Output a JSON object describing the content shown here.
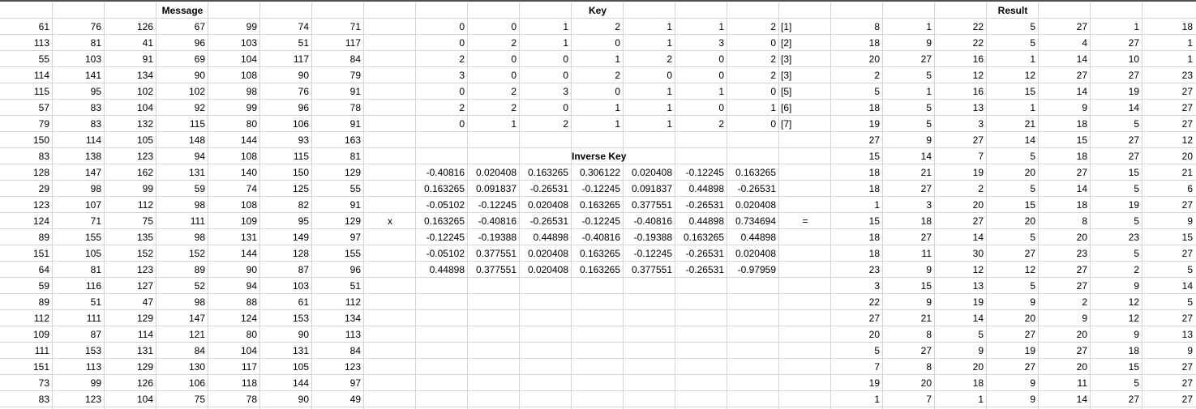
{
  "headers": {
    "message": "Message",
    "key": "Key",
    "inverse_key": "Inverse Key",
    "result": "Result"
  },
  "operators": {
    "multiply": "x",
    "equals": "="
  },
  "message": [
    [
      "61",
      "76",
      "126",
      "67",
      "99",
      "74",
      "71"
    ],
    [
      "113",
      "81",
      "41",
      "96",
      "103",
      "51",
      "117"
    ],
    [
      "55",
      "103",
      "91",
      "69",
      "104",
      "117",
      "84"
    ],
    [
      "114",
      "141",
      "134",
      "90",
      "108",
      "90",
      "79"
    ],
    [
      "115",
      "95",
      "102",
      "102",
      "98",
      "76",
      "91"
    ],
    [
      "57",
      "83",
      "104",
      "92",
      "99",
      "96",
      "78"
    ],
    [
      "79",
      "83",
      "132",
      "115",
      "80",
      "106",
      "91"
    ],
    [
      "150",
      "114",
      "105",
      "148",
      "144",
      "93",
      "163"
    ],
    [
      "83",
      "138",
      "123",
      "94",
      "108",
      "115",
      "81"
    ],
    [
      "128",
      "147",
      "162",
      "131",
      "140",
      "150",
      "129"
    ],
    [
      "29",
      "98",
      "99",
      "59",
      "74",
      "125",
      "55"
    ],
    [
      "123",
      "107",
      "112",
      "98",
      "108",
      "82",
      "91"
    ],
    [
      "124",
      "71",
      "75",
      "111",
      "109",
      "95",
      "129"
    ],
    [
      "89",
      "155",
      "135",
      "98",
      "131",
      "149",
      "97"
    ],
    [
      "151",
      "105",
      "152",
      "152",
      "144",
      "128",
      "155"
    ],
    [
      "64",
      "81",
      "123",
      "89",
      "90",
      "87",
      "96"
    ],
    [
      "59",
      "116",
      "127",
      "52",
      "94",
      "103",
      "51"
    ],
    [
      "89",
      "51",
      "47",
      "98",
      "88",
      "61",
      "112"
    ],
    [
      "112",
      "111",
      "129",
      "147",
      "124",
      "153",
      "134"
    ],
    [
      "109",
      "87",
      "114",
      "121",
      "80",
      "90",
      "113"
    ],
    [
      "111",
      "153",
      "131",
      "84",
      "104",
      "131",
      "84"
    ],
    [
      "151",
      "113",
      "129",
      "130",
      "117",
      "105",
      "123"
    ],
    [
      "73",
      "99",
      "126",
      "106",
      "118",
      "144",
      "97"
    ],
    [
      "83",
      "123",
      "104",
      "75",
      "78",
      "90",
      "49"
    ]
  ],
  "key": [
    [
      "0",
      "0",
      "1",
      "2",
      "1",
      "1",
      "2"
    ],
    [
      "0",
      "2",
      "1",
      "0",
      "1",
      "3",
      "0"
    ],
    [
      "2",
      "0",
      "0",
      "1",
      "2",
      "0",
      "2"
    ],
    [
      "3",
      "0",
      "0",
      "2",
      "0",
      "0",
      "2"
    ],
    [
      "0",
      "2",
      "3",
      "0",
      "1",
      "1",
      "0"
    ],
    [
      "2",
      "2",
      "0",
      "1",
      "1",
      "0",
      "1"
    ],
    [
      "0",
      "1",
      "2",
      "1",
      "1",
      "2",
      "0"
    ]
  ],
  "key_tags": [
    "[1]",
    "[2]",
    "[3]",
    "[3]",
    "[5]",
    "[6]",
    "[7]"
  ],
  "inverse_key": [
    [
      "-0.40816",
      "0.020408",
      "0.163265",
      "0.306122",
      "0.020408",
      "-0.12245",
      "0.163265"
    ],
    [
      "0.163265",
      "0.091837",
      "-0.26531",
      "-0.12245",
      "0.091837",
      "0.44898",
      "-0.26531"
    ],
    [
      "-0.05102",
      "-0.12245",
      "0.020408",
      "0.163265",
      "0.377551",
      "-0.26531",
      "0.020408"
    ],
    [
      "0.163265",
      "-0.40816",
      "-0.26531",
      "-0.12245",
      "-0.40816",
      "0.44898",
      "0.734694"
    ],
    [
      "-0.12245",
      "-0.19388",
      "0.44898",
      "-0.40816",
      "-0.19388",
      "0.163265",
      "0.44898"
    ],
    [
      "-0.05102",
      "0.377551",
      "0.020408",
      "0.163265",
      "-0.12245",
      "-0.26531",
      "0.020408"
    ],
    [
      "0.44898",
      "0.377551",
      "0.020408",
      "0.163265",
      "0.377551",
      "-0.26531",
      "-0.97959"
    ]
  ],
  "result": [
    [
      "8",
      "1",
      "22",
      "5",
      "27",
      "1",
      "18"
    ],
    [
      "18",
      "9",
      "22",
      "5",
      "4",
      "27",
      "1"
    ],
    [
      "20",
      "27",
      "16",
      "1",
      "14",
      "10",
      "1"
    ],
    [
      "2",
      "5",
      "12",
      "12",
      "27",
      "27",
      "23"
    ],
    [
      "5",
      "1",
      "16",
      "15",
      "14",
      "19",
      "27"
    ],
    [
      "18",
      "5",
      "13",
      "1",
      "9",
      "14",
      "27"
    ],
    [
      "19",
      "5",
      "3",
      "21",
      "18",
      "5",
      "27"
    ],
    [
      "27",
      "9",
      "27",
      "14",
      "15",
      "27",
      "12"
    ],
    [
      "15",
      "14",
      "7",
      "5",
      "18",
      "27",
      "20"
    ],
    [
      "18",
      "21",
      "19",
      "20",
      "27",
      "15",
      "21"
    ],
    [
      "18",
      "27",
      "2",
      "5",
      "14",
      "5",
      "6"
    ],
    [
      "1",
      "3",
      "20",
      "15",
      "18",
      "19",
      "27"
    ],
    [
      "15",
      "18",
      "27",
      "20",
      "8",
      "5",
      "9"
    ],
    [
      "18",
      "27",
      "14",
      "5",
      "20",
      "23",
      "15"
    ],
    [
      "18",
      "11",
      "30",
      "27",
      "23",
      "5",
      "27"
    ],
    [
      "23",
      "9",
      "12",
      "12",
      "27",
      "2",
      "5"
    ],
    [
      "3",
      "15",
      "13",
      "5",
      "27",
      "9",
      "14"
    ],
    [
      "22",
      "9",
      "19",
      "9",
      "2",
      "12",
      "5"
    ],
    [
      "27",
      "21",
      "14",
      "20",
      "9",
      "12",
      "27"
    ],
    [
      "20",
      "8",
      "5",
      "27",
      "20",
      "9",
      "13"
    ],
    [
      "5",
      "27",
      "9",
      "19",
      "27",
      "18",
      "9"
    ],
    [
      "7",
      "8",
      "20",
      "27",
      "20",
      "15",
      "27"
    ],
    [
      "19",
      "20",
      "18",
      "9",
      "11",
      "5",
      "27"
    ],
    [
      "1",
      "7",
      "1",
      "9",
      "14",
      "27",
      "27"
    ]
  ]
}
